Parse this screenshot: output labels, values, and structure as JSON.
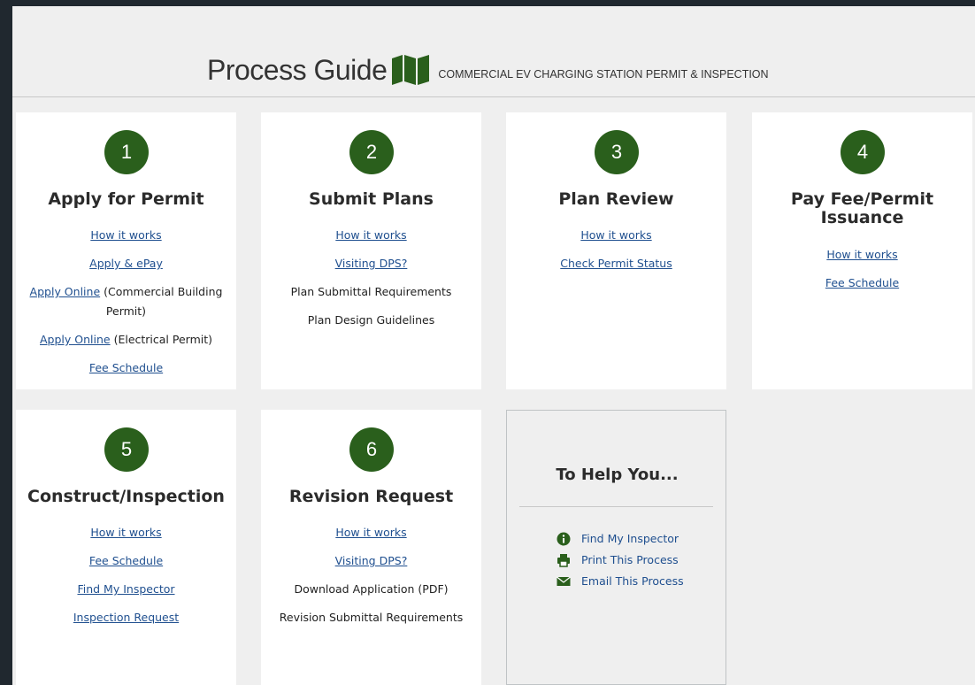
{
  "header": {
    "title": "Process Guide",
    "subtitle": "COMMERCIAL EV CHARGING STATION PERMIT & INSPECTION"
  },
  "colors": {
    "badge": "#2a5f1c",
    "link": "#1f4f8f",
    "frame": "#20282f"
  },
  "steps": [
    {
      "number": "1",
      "title": "Apply for Permit",
      "items": [
        {
          "link": "How it works",
          "text": ""
        },
        {
          "link": "Apply & ePay",
          "text": ""
        },
        {
          "link": "Apply Online",
          "text": " (Commercial Building Permit)"
        },
        {
          "link": "Apply Online",
          "text": " (Electrical Permit)"
        },
        {
          "link": "Fee Schedule",
          "text": ""
        }
      ]
    },
    {
      "number": "2",
      "title": "Submit Plans",
      "items": [
        {
          "link": "How it works",
          "text": ""
        },
        {
          "link": "Visiting DPS?",
          "text": ""
        },
        {
          "link": "",
          "text": "Plan Submittal Requirements"
        },
        {
          "link": "",
          "text": "Plan Design Guidelines"
        }
      ]
    },
    {
      "number": "3",
      "title": "Plan Review",
      "items": [
        {
          "link": "How it works",
          "text": ""
        },
        {
          "link": "Check Permit Status",
          "text": ""
        }
      ]
    },
    {
      "number": "4",
      "title": "Pay Fee/Permit Issuance",
      "items": [
        {
          "link": "How it works",
          "text": ""
        },
        {
          "link": "Fee Schedule",
          "text": ""
        }
      ]
    },
    {
      "number": "5",
      "title": "Construct/Inspection",
      "items": [
        {
          "link": "How it works",
          "text": ""
        },
        {
          "link": "Fee Schedule",
          "text": ""
        },
        {
          "link": "Find My Inspector",
          "text": ""
        },
        {
          "link": "Inspection Request",
          "text": ""
        }
      ]
    },
    {
      "number": "6",
      "title": "Revision Request",
      "items": [
        {
          "link": "How it works",
          "text": ""
        },
        {
          "link": "Visiting DPS?",
          "text": ""
        },
        {
          "link": "",
          "text": "Download Application (PDF)"
        },
        {
          "link": "",
          "text": "Revision Submittal Requirements"
        }
      ]
    }
  ],
  "help": {
    "title": "To Help You...",
    "items": [
      {
        "icon": "info-icon",
        "label": "Find My Inspector"
      },
      {
        "icon": "print-icon",
        "label": "Print This Process"
      },
      {
        "icon": "envelope-icon",
        "label": "Email This Process"
      }
    ]
  }
}
